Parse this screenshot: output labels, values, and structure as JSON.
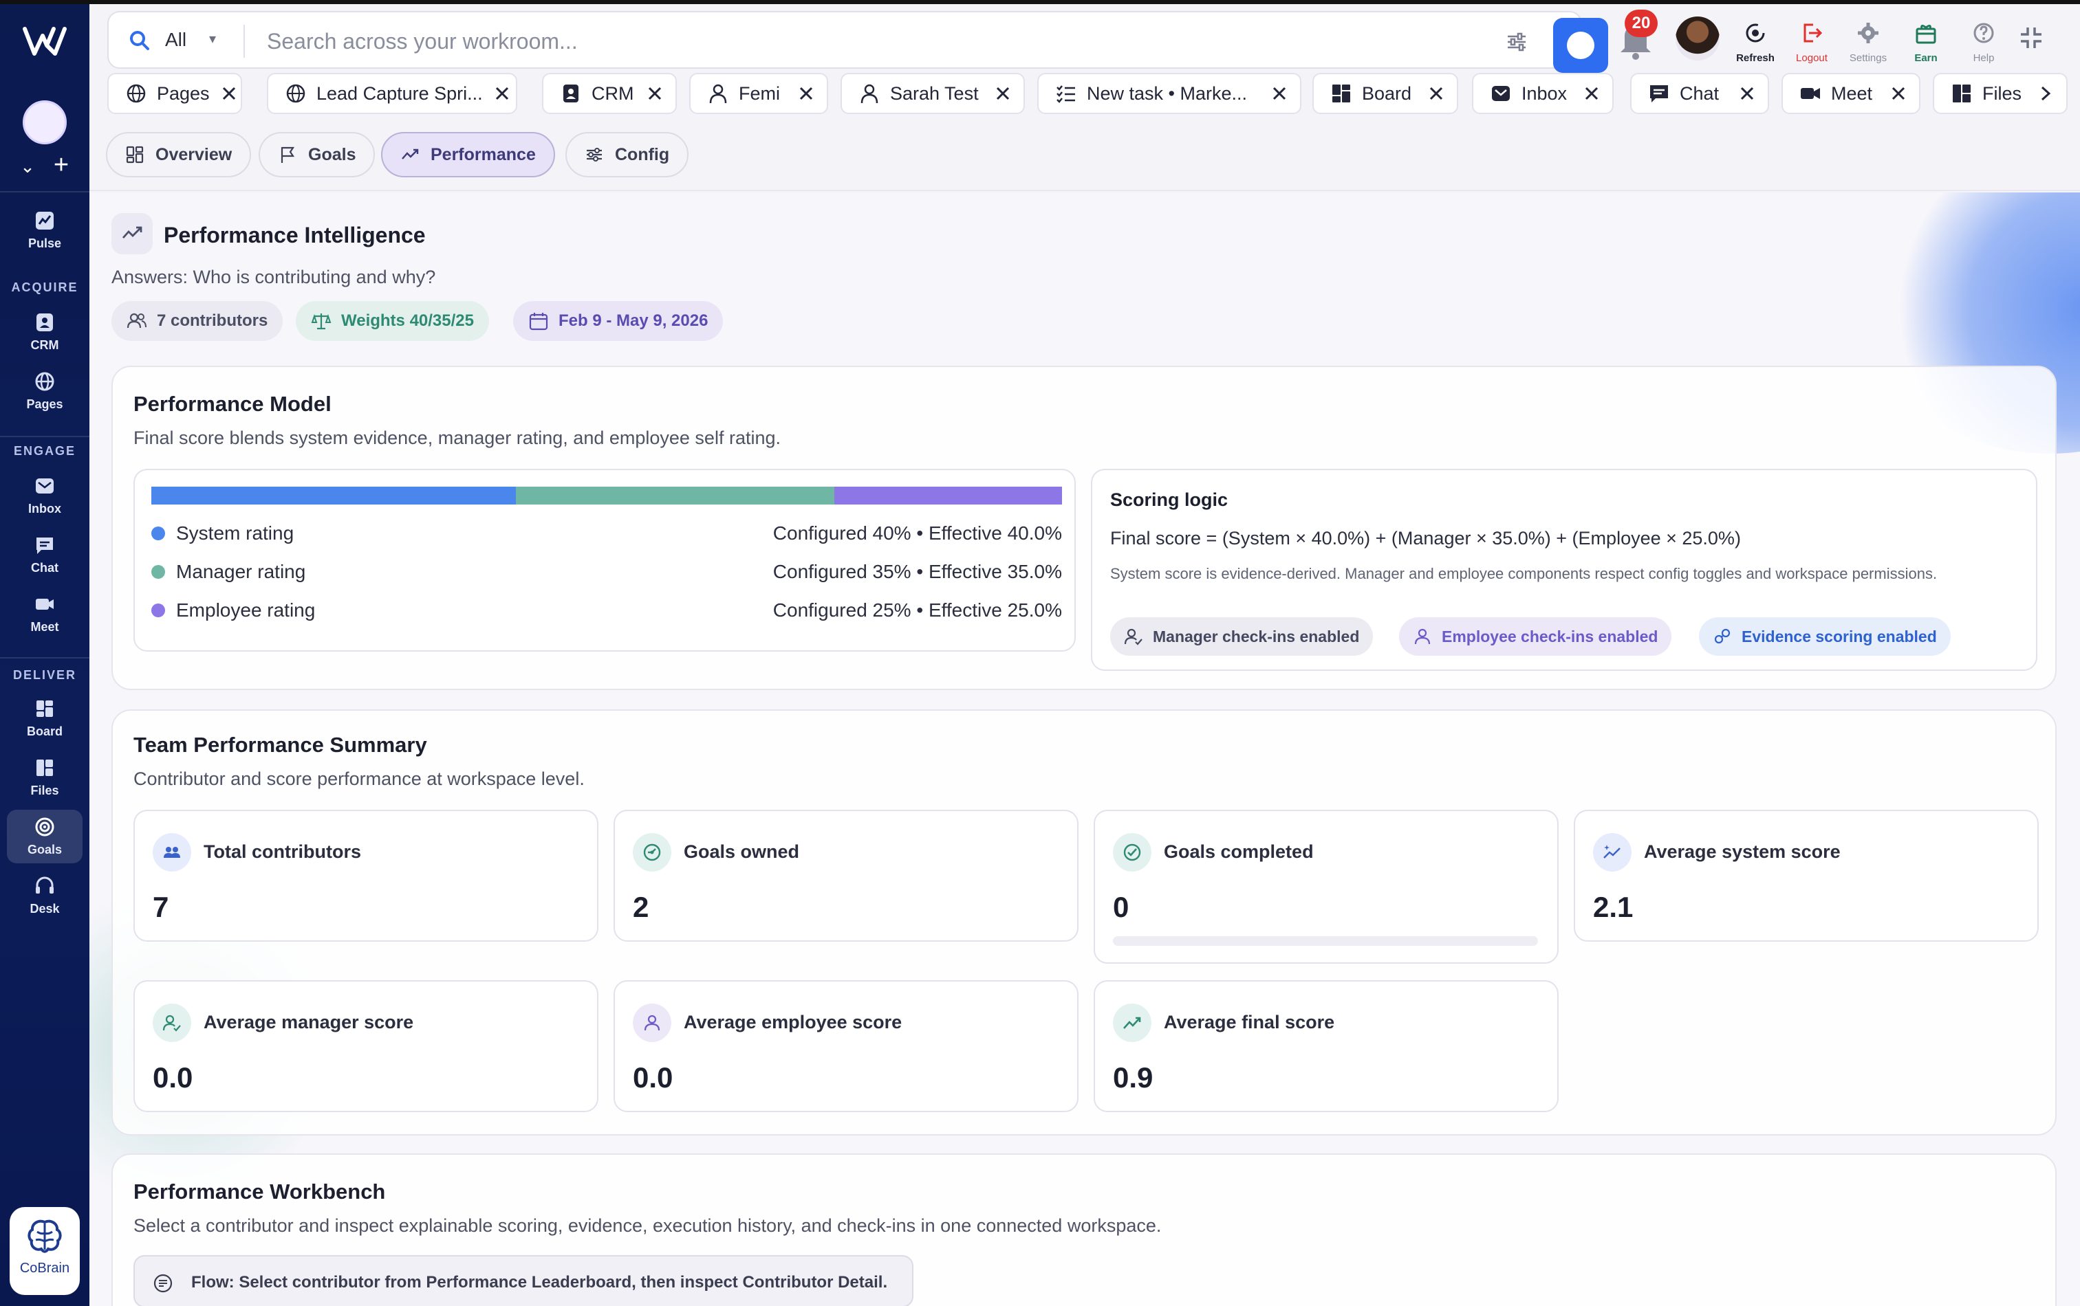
{
  "app": {
    "workspace_initial": "",
    "search": {
      "scope": "All",
      "placeholder": "Search across your workroom..."
    },
    "notifications_count": "20",
    "header_actions": [
      {
        "label": "Refresh",
        "icon": "refresh-icon",
        "color": "#1f2230"
      },
      {
        "label": "Logout",
        "icon": "logout-icon",
        "color": "#e0312f"
      },
      {
        "label": "Settings",
        "icon": "gear-icon",
        "color": "#8a8d9b"
      },
      {
        "label": "Earn",
        "icon": "gift-icon",
        "color": "#1f7a5a"
      },
      {
        "label": "Help",
        "icon": "help-icon",
        "color": "#8a8d9b"
      }
    ]
  },
  "sidebar": {
    "items": [
      {
        "label": "Pulse",
        "icon": "pulse-icon"
      },
      {
        "section": "ACQUIRE"
      },
      {
        "label": "CRM",
        "icon": "crm-icon"
      },
      {
        "label": "Pages",
        "icon": "globe-icon"
      },
      {
        "section": "ENGAGE"
      },
      {
        "label": "Inbox",
        "icon": "inbox-icon"
      },
      {
        "label": "Chat",
        "icon": "chat-icon"
      },
      {
        "label": "Meet",
        "icon": "video-icon"
      },
      {
        "section": "DELIVER"
      },
      {
        "label": "Board",
        "icon": "board-icon"
      },
      {
        "label": "Files",
        "icon": "files-icon"
      },
      {
        "label": "Goals",
        "icon": "target-icon",
        "active": true
      },
      {
        "label": "Desk",
        "icon": "headset-icon"
      }
    ],
    "cobrain_label": "CoBrain"
  },
  "tabs": [
    {
      "label": "Pages",
      "icon": "globe-icon"
    },
    {
      "label": "Lead Capture Spri...",
      "icon": "globe-icon"
    },
    {
      "label": "CRM",
      "icon": "crm-icon"
    },
    {
      "label": "Femi",
      "icon": "person-icon"
    },
    {
      "label": "Sarah Test",
      "icon": "person-icon"
    },
    {
      "label": "New task • Marke...",
      "icon": "checklist-icon"
    },
    {
      "label": "Board",
      "icon": "board-icon"
    },
    {
      "label": "Inbox",
      "icon": "inbox-icon"
    },
    {
      "label": "Chat",
      "icon": "chat-icon"
    },
    {
      "label": "Meet",
      "icon": "video-icon"
    },
    {
      "label": "Files",
      "icon": "files-icon"
    }
  ],
  "subnav": [
    {
      "label": "Overview",
      "icon": "grid-icon"
    },
    {
      "label": "Goals",
      "icon": "flag-icon"
    },
    {
      "label": "Performance",
      "icon": "trend-icon",
      "active": true
    },
    {
      "label": "Config",
      "icon": "sliders-icon"
    }
  ],
  "performance": {
    "title": "Performance Intelligence",
    "subtitle": "Answers: Who is contributing and why?",
    "chips": [
      {
        "label": "7 contributors",
        "icon": "people-icon"
      },
      {
        "label": "Weights 40/35/25",
        "icon": "scale-icon"
      },
      {
        "label": "Feb 9 - May 9, 2026",
        "icon": "calendar-icon"
      }
    ]
  },
  "model": {
    "title": "Performance Model",
    "subtitle": "Final score blends system evidence, manager rating, and employee self rating.",
    "weights": [
      {
        "name": "System rating",
        "value": "Configured 40% • Effective 40.0%",
        "share": 40,
        "color": "#4a86ec"
      },
      {
        "name": "Manager rating",
        "value": "Configured 35% • Effective 35.0%",
        "share": 35,
        "color": "#6fb7a4"
      },
      {
        "name": "Employee rating",
        "value": "Configured 25% • Effective 25.0%",
        "share": 25,
        "color": "#8d76e6"
      }
    ],
    "logic": {
      "title": "Scoring logic",
      "formula": "Final score = (System × 40.0%) + (Manager × 35.0%) + (Employee × 25.0%)",
      "note": "System score is evidence-derived. Manager and employee components respect config toggles and workspace permissions.",
      "badges": [
        {
          "label": "Manager check-ins enabled",
          "icon": "user-check-icon"
        },
        {
          "label": "Employee check-ins enabled",
          "icon": "person-icon"
        },
        {
          "label": "Evidence scoring enabled",
          "icon": "link-icon"
        }
      ]
    }
  },
  "team": {
    "title": "Team Performance Summary",
    "subtitle": "Contributor and score performance at workspace level.",
    "stats": [
      {
        "label": "Total contributors",
        "value": "7",
        "icon": "people-icon"
      },
      {
        "label": "Goals owned",
        "value": "2",
        "icon": "target-icon"
      },
      {
        "label": "Goals completed",
        "value": "0",
        "icon": "check-circle-icon",
        "progress": 0
      },
      {
        "label": "Average system score",
        "value": "2.1",
        "icon": "sparkle-trend-icon"
      },
      {
        "label": "Average manager score",
        "value": "0.0",
        "icon": "user-check-icon"
      },
      {
        "label": "Average employee score",
        "value": "0.0",
        "icon": "person-icon"
      },
      {
        "label": "Average final score",
        "value": "0.9",
        "icon": "trend-icon"
      }
    ]
  },
  "workbench": {
    "title": "Performance Workbench",
    "subtitle": "Select a contributor and inspect explainable scoring, evidence, execution history, and check-ins in one connected workspace.",
    "flow": "Flow: Select contributor from Performance Leaderboard, then inspect Contributor Detail."
  }
}
